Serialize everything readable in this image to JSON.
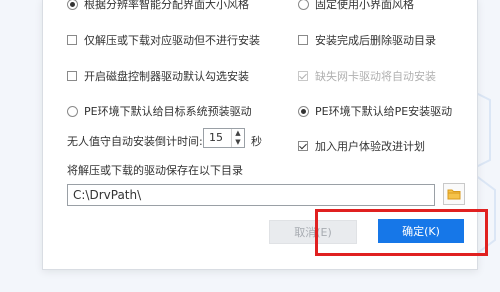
{
  "options": {
    "opt_resolution": "根据分辨率智能分配界面大小风格",
    "opt_fixed_small": "固定使用小界面风格",
    "opt_decompress_only": "仅解压或下载对应驱动但不进行安装",
    "opt_delete_dir": "安装完成后删除驱动目录",
    "opt_disk_controller": "开启磁盘控制器驱动默认勾选安装",
    "opt_wifi_auto": "缺失网卡驱动将自动安装",
    "opt_pe_preinstall": "PE环境下默认给目标系统预装驱动",
    "opt_pe_install": "PE环境下默认给PE安装驱动",
    "unattended_label": "无人值守自动安装倒计时间:",
    "countdown_value": "15",
    "seconds_unit": "秒",
    "opt_ux_plan": "加入用户体验改进计划"
  },
  "save_dir": {
    "label": "将解压或下载的驱动保存在以下目录",
    "path": "C:\\DrvPath\\"
  },
  "buttons": {
    "cancel": "取消(E)",
    "ok": "确定(K)"
  },
  "colors": {
    "accent": "#1677e8",
    "highlight": "#e02020"
  }
}
